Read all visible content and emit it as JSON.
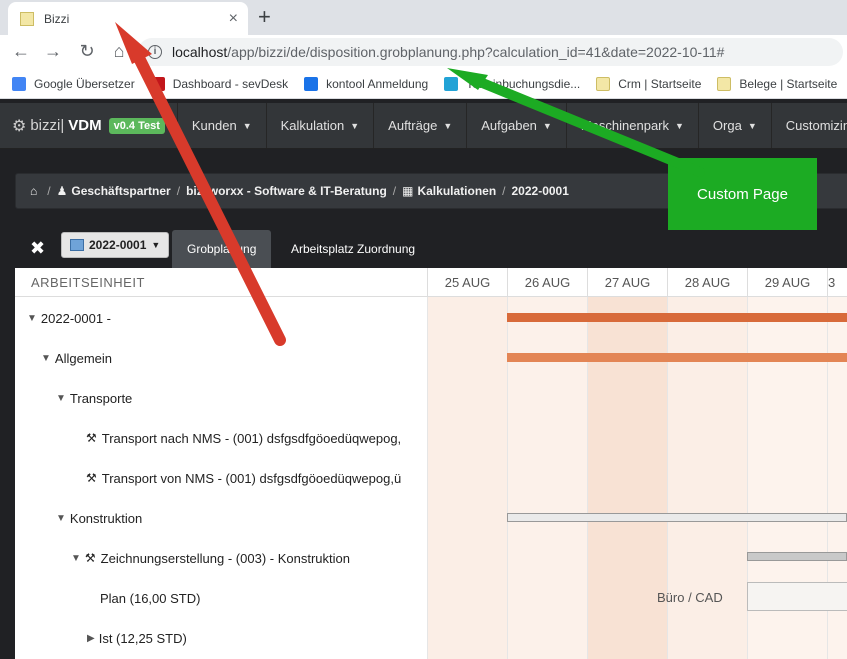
{
  "browser": {
    "tab_title": "Bizzi",
    "tab_close": "×",
    "new_tab": "+",
    "url_host": "localhost",
    "url_path": "/app/bizzi/de/disposition.grobplanung.php?calculation_id=41&date=2022-10-11#",
    "bookmarks": [
      {
        "label": "Google Übersetzer",
        "color": "#4285f4"
      },
      {
        "label": "Dashboard - sevDesk",
        "color": "#c2161b"
      },
      {
        "label": "kontool Anmeldung",
        "color": "#1a73e8"
      },
      {
        "label": "Terminbuchungsdie...",
        "color": "#22a3d6"
      },
      {
        "label": "Crm | Startseite",
        "color": "#f3e7a6"
      },
      {
        "label": "Belege | Startseite",
        "color": "#f3e7a6"
      }
    ]
  },
  "app": {
    "brand_name": "bizzi",
    "brand_sep": " |",
    "brand_product": "VDM",
    "brand_badge": "v0.4 Test",
    "nav": [
      "Kunden",
      "Kalkulation",
      "Aufträge",
      "Aufgaben",
      "Maschinenpark",
      "Orga",
      "Customizing"
    ]
  },
  "breadcrumb": [
    "Geschäftspartner",
    "bizzworxx - Software & IT-Beratung",
    "Kalkulationen",
    "2022-0001"
  ],
  "subnav": {
    "close": "✖",
    "calc": "2022-0001",
    "tabs": [
      "Grobplanung",
      "Arbeitsplatz Zuordnung"
    ]
  },
  "gantt": {
    "column_header": "ARBEITSEINHEIT",
    "days": [
      "25 AUG",
      "26 AUG",
      "27 AUG",
      "28 AUG",
      "29 AUG",
      "3"
    ],
    "rows": [
      {
        "label": "2022-0001 -",
        "tri": "▼",
        "tool": false
      },
      {
        "label": "Allgemein",
        "tri": "▼",
        "tool": false
      },
      {
        "label": "Transporte",
        "tri": "▼",
        "tool": false
      },
      {
        "label": "Transport nach NMS - (001) dsfgsdfgöoedüqwepog,",
        "tri": "",
        "tool": true
      },
      {
        "label": "Transport von NMS - (001) dsfgsdfgöoedüqwepog,ü",
        "tri": "",
        "tool": true
      },
      {
        "label": "Konstruktion",
        "tri": "▼",
        "tool": false
      },
      {
        "label": "Zeichnungserstellung - (003) - Konstruktion",
        "tri": "▼",
        "tool": true
      },
      {
        "label": "Plan (16,00 STD)",
        "tri": "",
        "tool": false
      },
      {
        "label": "Ist (12,25 STD)",
        "tri": "▶",
        "tool": false
      }
    ],
    "resource_label": "Büro / CAD"
  },
  "annotation": {
    "label": "Custom Page",
    "red": "#d83a2b",
    "green": "#1cab23"
  }
}
